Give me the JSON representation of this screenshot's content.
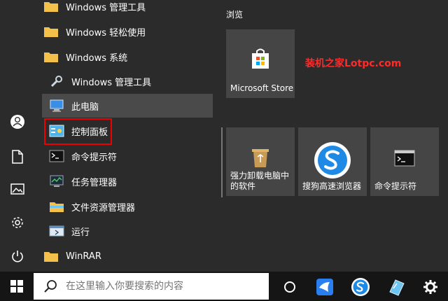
{
  "start_list": {
    "items": [
      {
        "label": "Windows 管理工具"
      },
      {
        "label": "Windows 轻松使用"
      },
      {
        "label": "Windows 系统"
      },
      {
        "label": "Windows 管理工具"
      },
      {
        "label": "此电脑"
      },
      {
        "label": "控制面板"
      },
      {
        "label": "命令提示符"
      },
      {
        "label": "任务管理器"
      },
      {
        "label": "文件资源管理器"
      },
      {
        "label": "运行"
      },
      {
        "label": "WinRAR"
      }
    ]
  },
  "tiles": {
    "group_label": "浏览",
    "store": "Microsoft Store",
    "uninstall": "强力卸载电脑中\n的软件",
    "sogou": "搜狗高速浏览器",
    "cmd": "命令提示符"
  },
  "watermark": "装机之家Lotpc.com",
  "taskbar": {
    "search_placeholder": "在这里输入你要搜索的内容"
  },
  "colors": {
    "menu_bg": "#2b2b2b",
    "tile_bg": "#454545",
    "taskbar_bg": "#151515",
    "highlight": "#e00000",
    "folder": "#f3c14a"
  }
}
